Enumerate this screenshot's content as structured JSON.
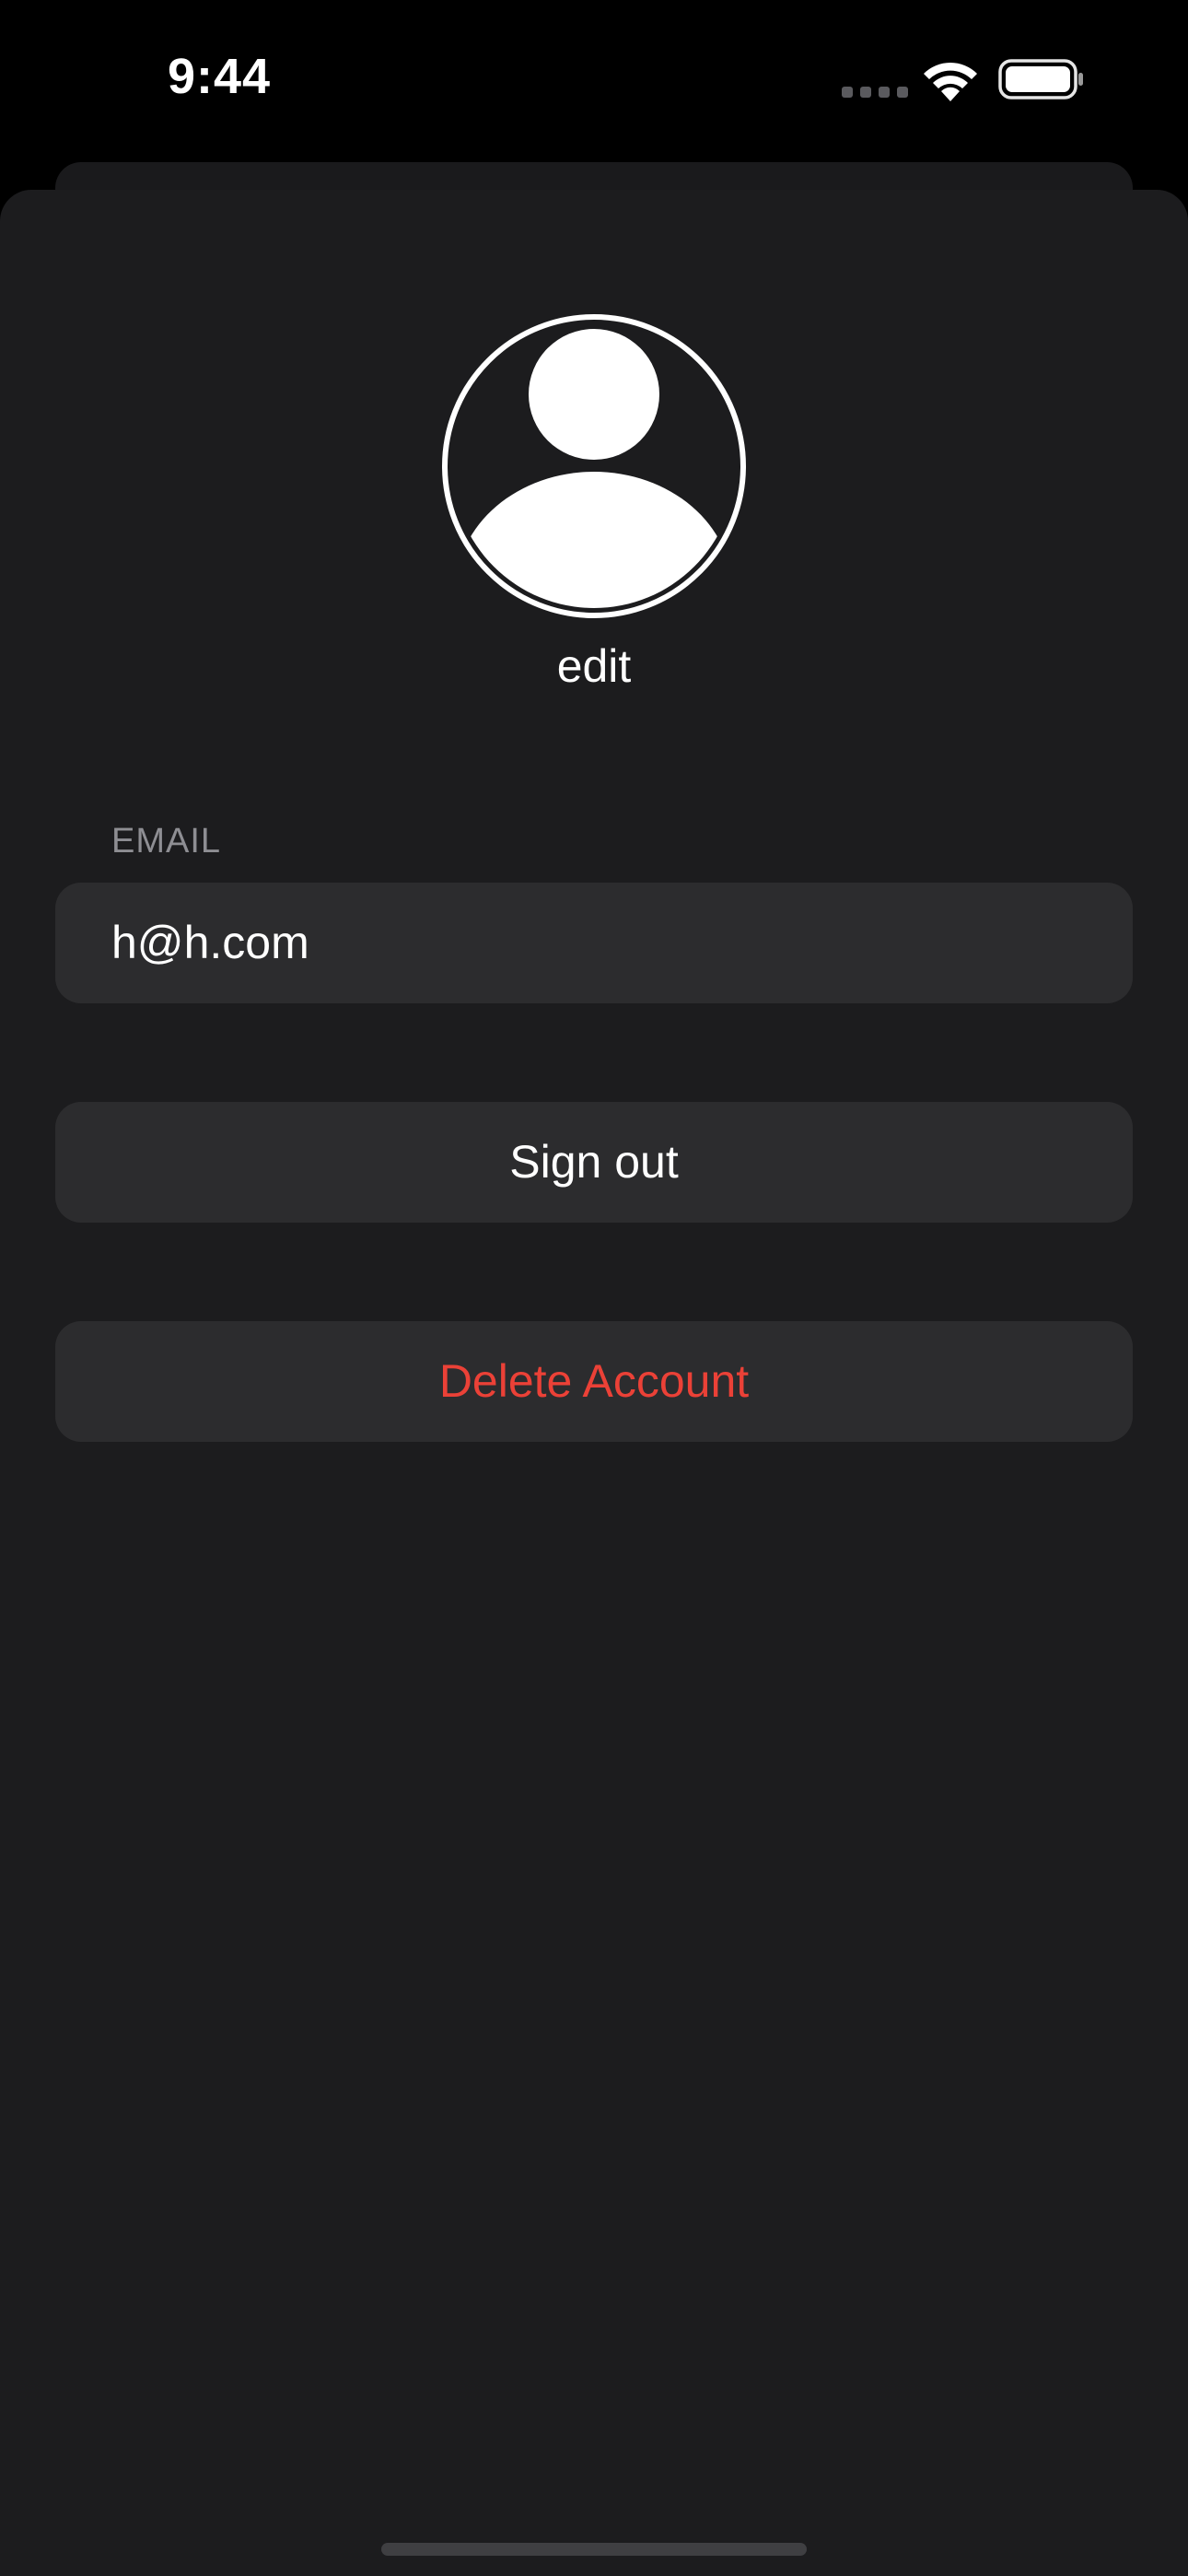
{
  "status_bar": {
    "time": "9:44",
    "icons": [
      "cellular-signal-icon",
      "wifi-icon",
      "battery-icon"
    ]
  },
  "profile": {
    "avatar_icon": "person-circle-icon",
    "edit_label": "edit"
  },
  "email_section": {
    "header": "EMAIL",
    "value": "h@h.com"
  },
  "actions": {
    "sign_out_label": "Sign out",
    "delete_account_label": "Delete Account"
  },
  "colors": {
    "background": "#000000",
    "sheet": "#1c1c1e",
    "cell": "#2c2c2e",
    "secondary_text": "#8e8e93",
    "destructive": "#eb4137"
  }
}
